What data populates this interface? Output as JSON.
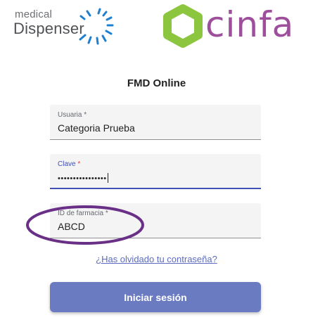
{
  "logos": {
    "medical_dispenser": {
      "line1": "medical",
      "line2": "Dispenser"
    },
    "cinfa": {
      "text": "cinfa"
    }
  },
  "title": "FMD Online",
  "fields": {
    "usuario": {
      "label": "Usuaria",
      "required_mark": "*",
      "value": "Categoria Prueba"
    },
    "clave": {
      "label": "Clave",
      "required_mark": "*",
      "value": "••••••••••••••••"
    },
    "farmacia": {
      "label": "ID de farmacia",
      "required_mark": "*",
      "value": "ABCD"
    }
  },
  "forgot_link": "¿Has olvidado tu contraseña?",
  "submit_button": "Iniciar sesión",
  "colors": {
    "accent": "#3f51b5",
    "button": "#6b7bc1",
    "cinfa_green": "#8cc63f",
    "cinfa_purple": "#9d4f9c",
    "annotation": "#6a2f86",
    "dispenser_blue": "#1e7fd0"
  }
}
